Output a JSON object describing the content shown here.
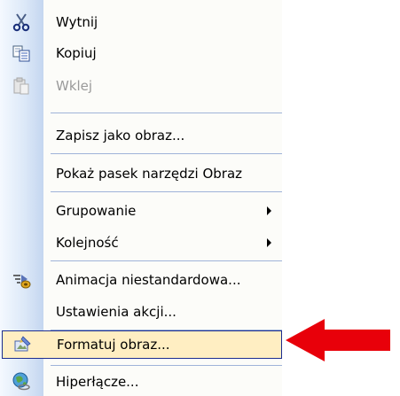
{
  "menu": {
    "items": [
      {
        "label": "Wytnij",
        "icon": "scissors-icon",
        "enabled": true
      },
      {
        "label": "Kopiuj",
        "icon": "copy-icon",
        "enabled": true
      },
      {
        "label": "Wklej",
        "icon": "paste-icon",
        "enabled": false
      },
      {
        "label": "Zapisz jako obraz..."
      },
      {
        "label": "Pokaż pasek narzędzi Obraz"
      },
      {
        "label": "Grupowanie",
        "submenu": true
      },
      {
        "label": "Kolejność",
        "submenu": true
      },
      {
        "label": "Animacja niestandardowa...",
        "icon": "animation-icon"
      },
      {
        "label": "Ustawienia akcji..."
      },
      {
        "label": "Formatuj obraz...",
        "icon": "format-picture-icon",
        "highlighted": true
      },
      {
        "label": "Hiperłącze...",
        "icon": "hyperlink-icon"
      }
    ]
  },
  "colors": {
    "highlight_fill": "#ffeec2",
    "highlight_border": "#1c2d8f",
    "separator": "#9fb3d9",
    "arrow": "#e8000a",
    "disabled_text": "#9a9a9a"
  }
}
